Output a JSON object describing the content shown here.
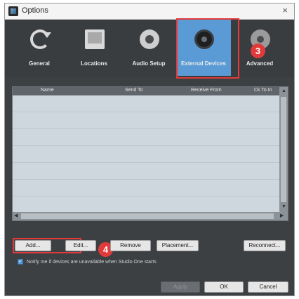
{
  "window": {
    "title": "Options",
    "close_glyph": "×"
  },
  "toolbar": {
    "items": [
      {
        "label": "General",
        "icon": "refresh-icon"
      },
      {
        "label": "Locations",
        "icon": "folder-icon"
      },
      {
        "label": "Audio Setup",
        "icon": "speaker-icon"
      },
      {
        "label": "External Devices",
        "icon": "knob-icon",
        "active": true
      },
      {
        "label": "Advanced",
        "icon": "gear-icon"
      }
    ]
  },
  "callouts": {
    "step3": "3",
    "step4": "4"
  },
  "table": {
    "columns": [
      "Name",
      "Send To",
      "Receive From",
      "Ck To In"
    ],
    "rows": []
  },
  "buttons": {
    "add": "Add...",
    "edit": "Edit...",
    "remove": "Remove",
    "placement": "Placement...",
    "reconnect": "Reconnect...",
    "apply": "Apply",
    "ok": "OK",
    "cancel": "Cancel"
  },
  "notify": {
    "checked": true,
    "label": "Notify me if devices are unavailable when Studio One starts"
  },
  "colors": {
    "accent": "#5a9bd5",
    "callout": "#e23a3a",
    "dialog_bg": "#3c4043",
    "list_bg": "#cfd7de"
  }
}
